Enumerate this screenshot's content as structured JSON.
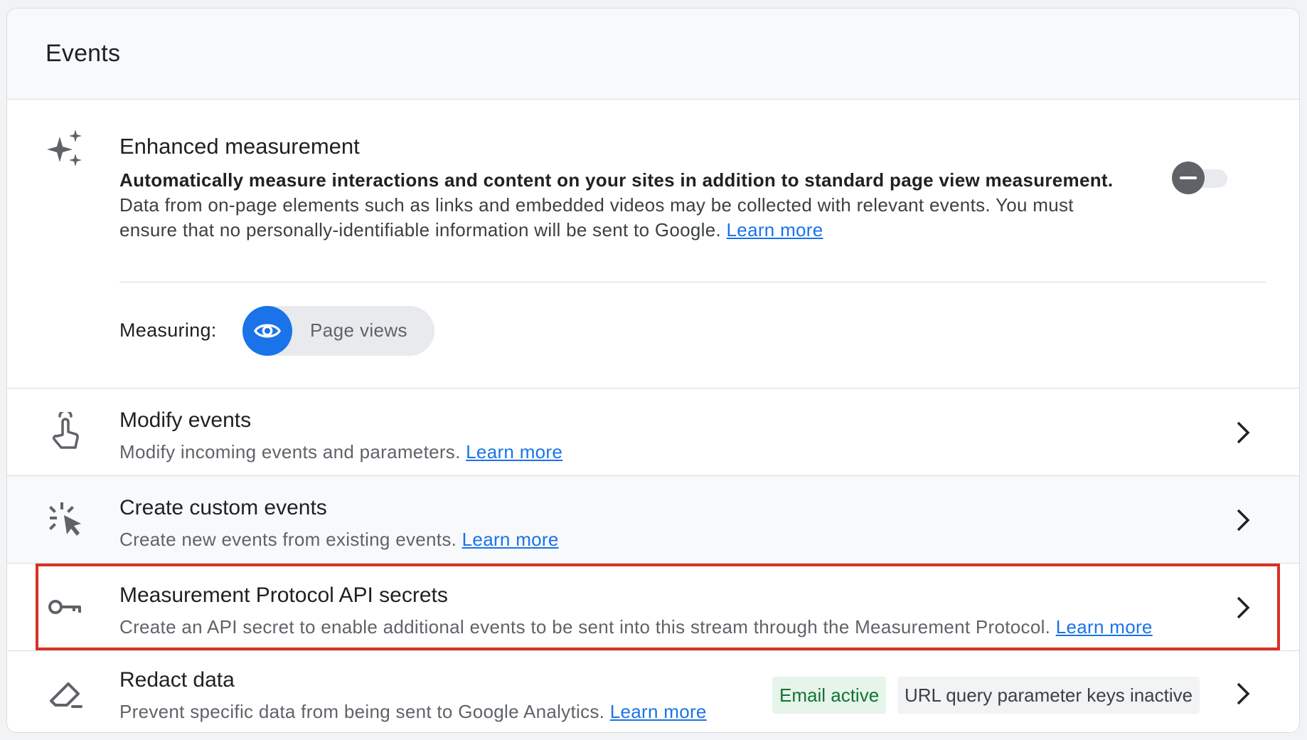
{
  "card": {
    "title": "Events"
  },
  "enhanced_measurement": {
    "title": "Enhanced measurement",
    "description_bold": "Automatically measure interactions and content on your sites in addition to standard page view measurement.",
    "description_rest": "Data from on-page elements such as links and embedded videos may be collected with relevant events. You must ensure that no personally-identifiable information will be sent to Google.",
    "learn_more": "Learn more",
    "toggle_state": "off",
    "measuring_label": "Measuring:",
    "measuring_chip": "Page views",
    "icon": "sparkle-icon"
  },
  "rows": {
    "modify": {
      "title": "Modify events",
      "description": "Modify incoming events and parameters.",
      "learn_more": "Learn more",
      "icon": "touch-hand-icon"
    },
    "custom": {
      "title": "Create custom events",
      "description": "Create new events from existing events.",
      "learn_more": "Learn more",
      "icon": "cursor-click-icon"
    },
    "mp_secrets": {
      "title": "Measurement Protocol API secrets",
      "description": "Create an API secret to enable additional events to be sent into this stream through the Measurement Protocol.",
      "learn_more": "Learn more",
      "icon": "key-icon"
    },
    "redact": {
      "title": "Redact data",
      "description": "Prevent specific data from being sent to Google Analytics.",
      "learn_more": "Learn more",
      "icon": "eraser-icon",
      "badge_email": "Email active",
      "badge_url": "URL query parameter keys inactive"
    }
  },
  "colors": {
    "link": "#1a73e8",
    "highlight": "#d93025",
    "badge_active_bg": "#e6f4ea",
    "badge_active_text": "#137333"
  }
}
